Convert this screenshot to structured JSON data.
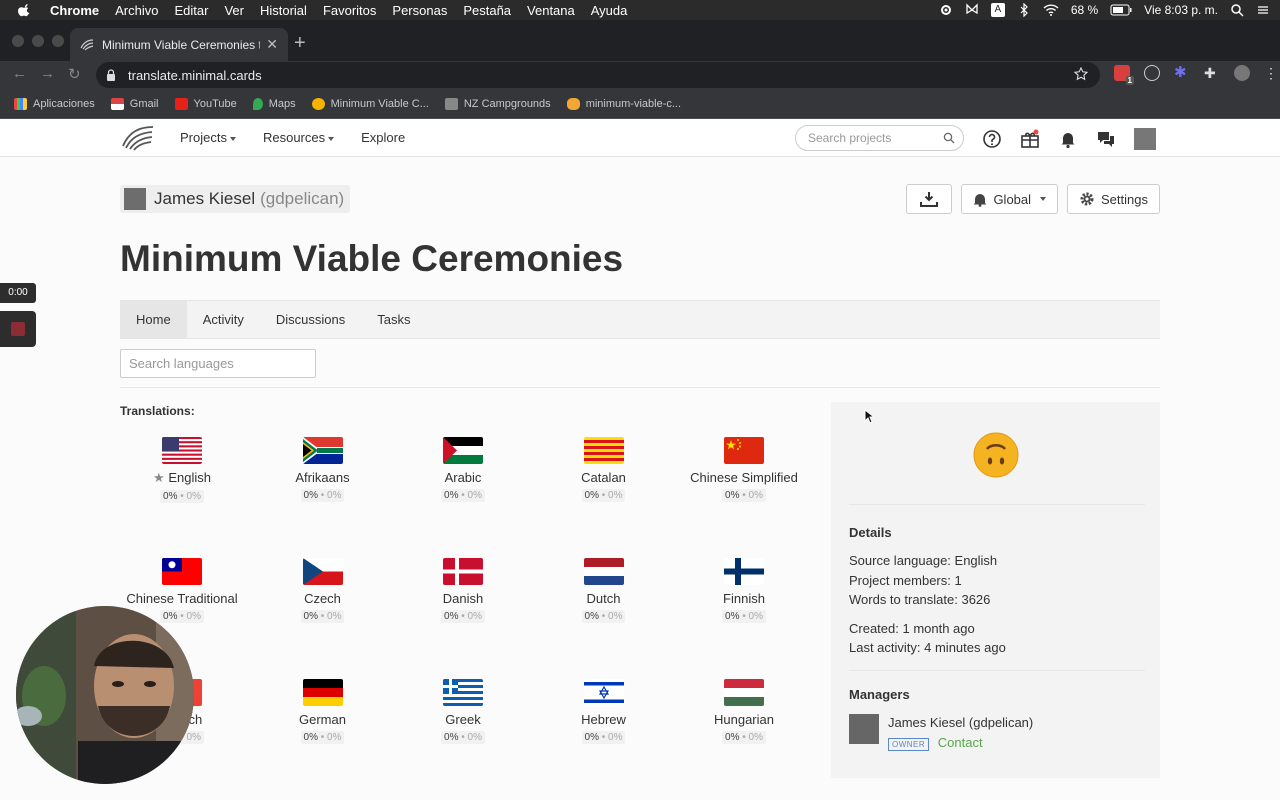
{
  "mac_menubar": {
    "app": "Chrome",
    "menus": [
      "Archivo",
      "Editar",
      "Ver",
      "Historial",
      "Favoritos",
      "Personas",
      "Pestaña",
      "Ventana",
      "Ayuda"
    ],
    "battery": "68 %",
    "clock": "Vie 8:03 p. m."
  },
  "browser": {
    "tab_title": "Minimum Viable Ceremonies tr",
    "url": "translate.minimal.cards",
    "bookmarks": [
      "Aplicaciones",
      "Gmail",
      "YouTube",
      "Maps",
      "Minimum Viable C...",
      "NZ Campgrounds",
      "minimum-viable-c..."
    ],
    "ext_badge": "1"
  },
  "site_nav": {
    "links": [
      "Projects",
      "Resources",
      "Explore"
    ],
    "search_placeholder": "Search projects"
  },
  "project": {
    "owner_name": "James Kiesel",
    "owner_handle": "(gdpelican)",
    "title": "Minimum Viable Ceremonies",
    "buttons": {
      "global": "Global",
      "settings": "Settings"
    },
    "tabs": [
      "Home",
      "Activity",
      "Discussions",
      "Tasks"
    ],
    "lang_search_placeholder": "Search languages",
    "translations_label": "Translations:"
  },
  "languages": [
    {
      "name": "English",
      "source": true,
      "flag": "us"
    },
    {
      "name": "Afrikaans",
      "flag": "za"
    },
    {
      "name": "Arabic",
      "flag": "ar"
    },
    {
      "name": "Catalan",
      "flag": "cat"
    },
    {
      "name": "Chinese Simplified",
      "flag": "cn"
    },
    {
      "name": "Chinese Traditional",
      "flag": "tw"
    },
    {
      "name": "Czech",
      "flag": "cz"
    },
    {
      "name": "Danish",
      "flag": "dk"
    },
    {
      "name": "Dutch",
      "flag": "nl"
    },
    {
      "name": "Finnish",
      "flag": "fi"
    },
    {
      "name": "French",
      "flag": "fr"
    },
    {
      "name": "German",
      "flag": "de"
    },
    {
      "name": "Greek",
      "flag": "gr"
    },
    {
      "name": "Hebrew",
      "flag": "il"
    },
    {
      "name": "Hungarian",
      "flag": "hu"
    }
  ],
  "progress": {
    "approved": "0%",
    "translated": "0%"
  },
  "sidebar": {
    "details_heading": "Details",
    "source_language": "Source language: English",
    "members": "Project members: 1",
    "words": "Words to translate: 3626",
    "created": "Created: 1 month ago",
    "last_activity": "Last activity: 4 minutes ago",
    "managers_heading": "Managers",
    "manager_name": "James Kiesel (gdpelican)",
    "owner_badge": "OWNER",
    "contact": "Contact"
  },
  "recording": {
    "timer": "0:00"
  },
  "colors": {
    "contact_green": "#57a64a",
    "owner_blue": "#5b88c7"
  }
}
